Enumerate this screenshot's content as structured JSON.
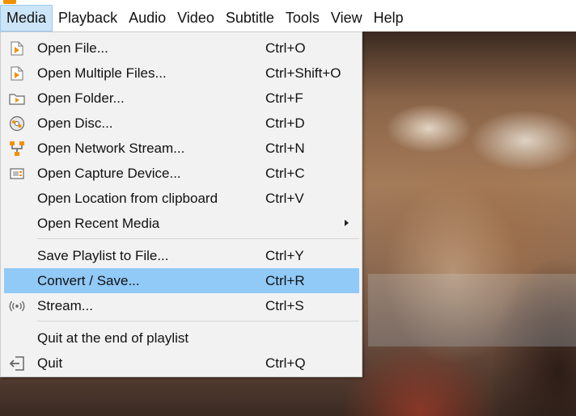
{
  "menubar": {
    "items": [
      {
        "label": "Media",
        "active": true
      },
      {
        "label": "Playback"
      },
      {
        "label": "Audio"
      },
      {
        "label": "Video"
      },
      {
        "label": "Subtitle"
      },
      {
        "label": "Tools"
      },
      {
        "label": "View"
      },
      {
        "label": "Help"
      }
    ]
  },
  "media_menu": {
    "items": [
      {
        "label": "Open File...",
        "shortcut": "Ctrl+O",
        "icon": "open-file-icon"
      },
      {
        "label": "Open Multiple Files...",
        "shortcut": "Ctrl+Shift+O",
        "icon": "open-multiple-files-icon"
      },
      {
        "label": "Open Folder...",
        "shortcut": "Ctrl+F",
        "icon": "folder-icon"
      },
      {
        "label": "Open Disc...",
        "shortcut": "Ctrl+D",
        "icon": "disc-icon"
      },
      {
        "label": "Open Network Stream...",
        "shortcut": "Ctrl+N",
        "icon": "network-icon"
      },
      {
        "label": "Open Capture Device...",
        "shortcut": "Ctrl+C",
        "icon": "capture-device-icon"
      },
      {
        "label": "Open Location from clipboard",
        "shortcut": "Ctrl+V",
        "icon": ""
      },
      {
        "label": "Open Recent Media",
        "shortcut": "",
        "icon": "",
        "submenu": true
      },
      {
        "label": "Save Playlist to File...",
        "shortcut": "Ctrl+Y",
        "icon": ""
      },
      {
        "label": "Convert / Save...",
        "shortcut": "Ctrl+R",
        "icon": "",
        "highlighted": true
      },
      {
        "label": "Stream...",
        "shortcut": "Ctrl+S",
        "icon": "stream-icon"
      },
      {
        "label": "Quit at the end of playlist",
        "shortcut": "",
        "icon": ""
      },
      {
        "label": "Quit",
        "shortcut": "Ctrl+Q",
        "icon": "quit-icon"
      }
    ]
  },
  "colors": {
    "highlight": "#91c9f7",
    "menubar_active": "#cce4f7",
    "vlc_orange": "#f29100"
  }
}
